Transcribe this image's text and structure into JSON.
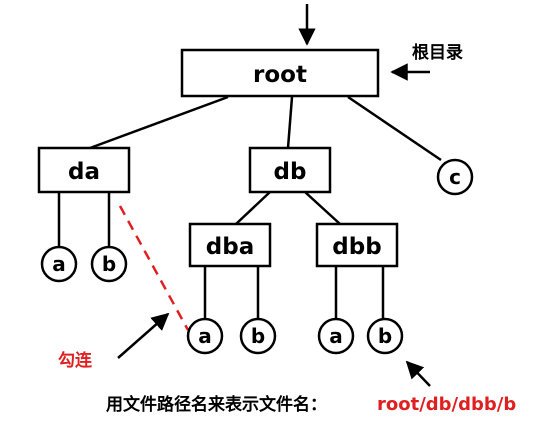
{
  "nodes": {
    "root": "root",
    "da": "da",
    "db": "db",
    "c": "c",
    "dba": "dba",
    "dbb": "dbb",
    "da_a": "a",
    "da_b": "b",
    "dba_a": "a",
    "dba_b": "b",
    "dbb_a": "a",
    "dbb_b": "b"
  },
  "labels": {
    "root_dir": "根目录",
    "hook_link": "勾连",
    "path_caption": "用文件路径名来表示文件名：",
    "path_value": "root/db/dbb/b"
  },
  "colors": {
    "stroke": "#000000",
    "link": "#e02020",
    "path": "#e02020"
  }
}
